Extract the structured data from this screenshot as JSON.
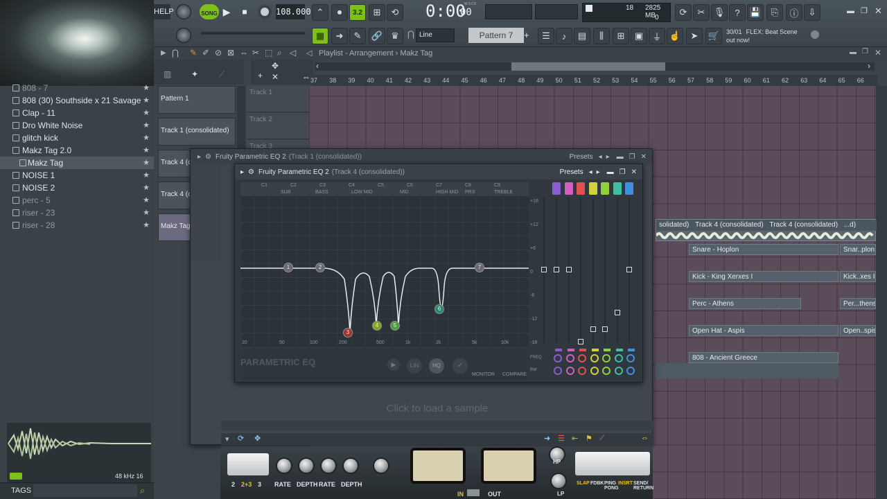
{
  "toolbar": {
    "help_label": "HELP",
    "song_label": "SONG",
    "pat_label": "PAT",
    "tempo": "108.000",
    "time_display": "0:00",
    "time_sub": "00",
    "time_unit": "M:S:CS",
    "step_label": "3.2",
    "cpu_value": "18",
    "memory": "2825 MB",
    "memory_sub": "0",
    "snap_value": "Line",
    "pattern_selector": "Pattern 7",
    "news_date": "30/01",
    "news_text": "FLEX: Beat Scene",
    "news_subtext": "out now!"
  },
  "browser": {
    "items": [
      {
        "label": "808 - 7",
        "dim": true
      },
      {
        "label": "808 (30) Southside x 21 Savage",
        "dim": false
      },
      {
        "label": "Clap - 11",
        "dim": false
      },
      {
        "label": "Dro White Noise",
        "dim": false
      },
      {
        "label": "glitch kick",
        "dim": false
      },
      {
        "label": "Makz Tag 2.0",
        "dim": false
      },
      {
        "label": "Makz Tag",
        "dim": false
      },
      {
        "label": "NOISE 1",
        "dim": false
      },
      {
        "label": "NOISE 2",
        "dim": false
      },
      {
        "label": "perc - 5",
        "dim": true
      },
      {
        "label": "riser - 23",
        "dim": true
      },
      {
        "label": "riser - 28",
        "dim": true
      }
    ],
    "sample_info": "48 kHz 16",
    "tags_label": "TAGS"
  },
  "playlist": {
    "breadcrumb": "Playlist - Arrangement › Makz Tag",
    "ruler": [
      "37",
      "38",
      "39",
      "40",
      "41",
      "42",
      "43",
      "44",
      "45",
      "46",
      "47",
      "48",
      "49",
      "50",
      "51",
      "52",
      "53",
      "54",
      "55",
      "56",
      "57",
      "58",
      "59",
      "60",
      "61",
      "62",
      "63",
      "64",
      "65",
      "66"
    ],
    "patterns": [
      "Pattern 1",
      "Track 1 (consolidated)",
      "Track 4 (co",
      "Track 4 (co",
      "Makz Tag"
    ],
    "tracks": [
      "Track 1",
      "Track 2",
      "Track 3"
    ],
    "clip_labels": [
      "solidated)",
      "Track 4 (consolidated)",
      "Track 4 (consolidated)",
      "...d)",
      "Snare - Hoplon",
      "Snar..plon",
      "Kick - King Xerxes I",
      "Kick..xes I",
      "Perc - Athens",
      "Per...thens",
      "Open Hat - Aspis",
      "Open..spis",
      "808 - Ancient Greece"
    ]
  },
  "eq_back": {
    "title": "Fruity Parametric EQ 2",
    "subtitle": "(Track 1 (consolidated))",
    "presets_label": "Presets"
  },
  "eq_front": {
    "title": "Fruity Parametric EQ 2",
    "subtitle": "(Track 4 (consolidated))",
    "presets_label": "Presets",
    "notes": [
      "C1",
      "C2",
      "C3",
      "C4",
      "C5",
      "C6",
      "C7",
      "C8",
      "C9"
    ],
    "bands": [
      "SUB",
      "BASS",
      "LOW MID",
      "MID",
      "HIGH MID",
      "PRS",
      "TREBLE"
    ],
    "freq_labels": [
      "20",
      "50",
      "100",
      "200",
      "500",
      "1k",
      "2k",
      "5k",
      "10k"
    ],
    "db_labels": [
      "+18",
      "+12",
      "+6",
      "0",
      "-6",
      "-12",
      "-18"
    ],
    "logo_text": "PARAMETRIC EQ",
    "logo_sub": "2",
    "lin_label": "LIN",
    "hq_label": "HQ",
    "monitor_label": "MONITOR",
    "compare_label": "COMPARE",
    "freq_row": "FREQ",
    "bw_row": "BW",
    "node_numbers": [
      "1",
      "2",
      "3",
      "4",
      "5",
      "6",
      "7"
    ]
  },
  "sampler": {
    "placeholder": "Click to load a sample"
  },
  "plugin_bottom": {
    "mode_labels": [
      "2",
      "2+3",
      "3"
    ],
    "knob_labels": [
      "RATE",
      "DEPTH",
      "RATE",
      "DEPTH"
    ],
    "hp_label": "HP",
    "lp_label": "LP",
    "in_label": "IN",
    "out_label": "OUT",
    "mode_buttons": [
      "SLAP",
      "FDBK",
      "PING PONG",
      "INSRT",
      "SEND/ RETURN"
    ]
  }
}
